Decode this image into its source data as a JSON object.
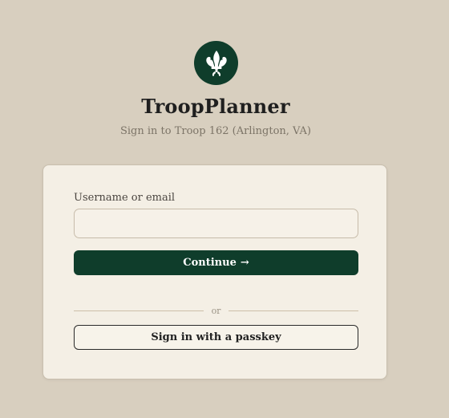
{
  "brand": {
    "title": "TroopPlanner",
    "subtitle": "Sign in to Troop 162 (Arlington, VA)",
    "logo_icon": "fleur-de-lis-icon",
    "accent_color": "#0f3d2b",
    "background_color": "#d8cfbf"
  },
  "login_form": {
    "username_label": "Username or email",
    "username_value": "",
    "username_placeholder": "",
    "continue_label": "Continue",
    "continue_icon": "arrow-right-icon",
    "continue_arrow": "→",
    "divider_text": "or",
    "passkey_label": "Sign in with a passkey"
  }
}
